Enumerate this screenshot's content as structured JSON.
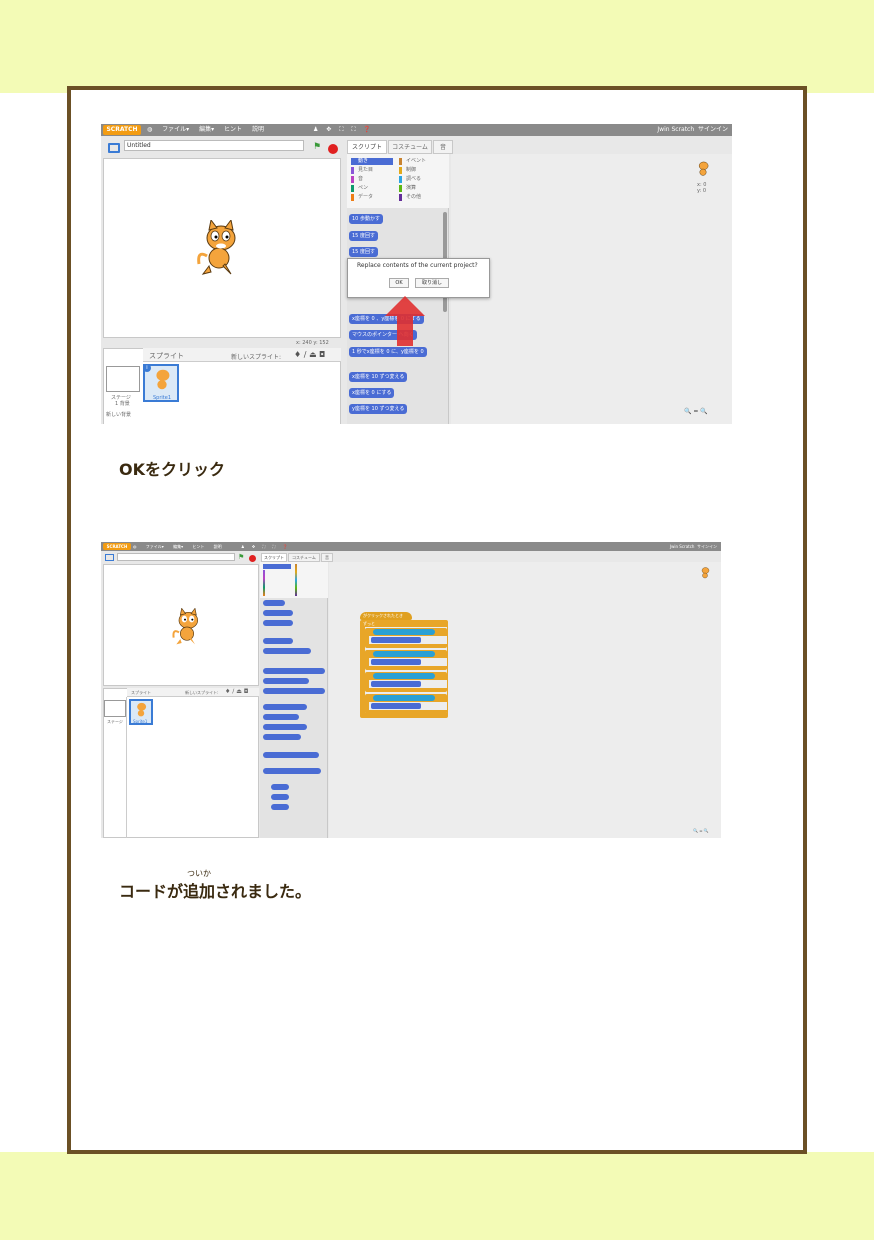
{
  "captions": {
    "step1": "OKをクリック",
    "step2_pre": "コードが",
    "step2_ruby_base": "追加",
    "step2_ruby_reading": "ついか",
    "step2_post": "されました。"
  },
  "screenshot1": {
    "menubar": {
      "logo": "SCRATCH",
      "items": [
        "ファイル▾",
        "編集▾",
        "ヒント",
        "説明"
      ],
      "icons": "♟ ✥ ⛶ ⛶ ❓",
      "user": "Jwin Scratch",
      "signin": "サインイン"
    },
    "project_title": "Untitled",
    "stage_coords": "x: 240   y: 152",
    "tabs": [
      "スクリプト",
      "コスチューム",
      "音"
    ],
    "categories_left": [
      "動き",
      "見た目",
      "音",
      "ペン",
      "データ"
    ],
    "categories_right": [
      "イベント",
      "制御",
      "調べる",
      "演算",
      "その他"
    ],
    "blocks": [
      "10 歩動かす",
      "15 度回す",
      "15 度回す",
      "x座標を 0 、y座標を 0 にする",
      "マウスのポインター へ向く",
      "1 秒でx座標を 0 に、y座標を 0",
      "x座標を 10 ずつ変える",
      "x座標を 0 にする",
      "y座標を 10 ずつ変える"
    ],
    "sprites_header": "スプライト",
    "new_sprite": "新しいスプライト:",
    "stage_label": "ステージ",
    "stage_sub": "1 背景",
    "new_backdrop": "新しい背景",
    "sprite_name": "Sprite1",
    "sprite_info": "x: 0\ny: 0",
    "dialog": {
      "message": "Replace contents of the current project?",
      "ok": "OK",
      "cancel": "取り消し"
    },
    "zoom": "🔍 = 🔍"
  },
  "screenshot2": {
    "menubar": {
      "logo": "SCRATCH",
      "items": [
        "ファイル▾",
        "編集▾",
        "ヒント",
        "説明"
      ],
      "icons": "♟ ✥ ⛶ ⛶ ❓",
      "user": "Jwin Scratch",
      "signin": "サインイン"
    },
    "tabs": [
      "スクリプト",
      "コスチューム",
      "音"
    ],
    "sprites_header": "スプライト",
    "new_sprite": "新しいスプライト:",
    "stage_label": "ステージ",
    "sprite_name": "Sprite1",
    "hat_block": "がクリックされたとき",
    "forever": "ずっと",
    "zoom": "🔍 = 🔍"
  },
  "colors": {
    "band": "#f3fbb6",
    "frame": "#6b5025",
    "motion": "#4a6cd4",
    "control": "#e8a628",
    "sensing": "#2aa0d4",
    "dialog_arrow": "#e03030"
  }
}
